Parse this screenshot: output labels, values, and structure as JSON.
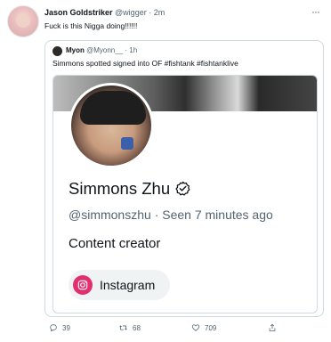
{
  "tweet": {
    "author_name": "Jason Goldstriker",
    "author_handle": "@wigger",
    "separator": "·",
    "time": "2m",
    "more_icon": "ellipsis-icon",
    "text": "Fuck is this Nigga doing!!!!!!"
  },
  "quote": {
    "author_name": "Myon",
    "author_handle": "@Myonn__",
    "separator": "·",
    "time": "1h",
    "text": "Simmons spotted signed into OF #fishtank #fishtanklive"
  },
  "profile": {
    "display_name": "Simmons Zhu",
    "verified_icon": "verified-check-icon",
    "handle": "@simmonszhu",
    "separator": "·",
    "seen": "Seen 7 minutes ago",
    "bio": "Content creator",
    "link_label": "Instagram",
    "link_icon": "instagram-icon",
    "accent_color": "#e1306c"
  },
  "actions": {
    "replies": "39",
    "retweets": "68",
    "likes": "709"
  }
}
